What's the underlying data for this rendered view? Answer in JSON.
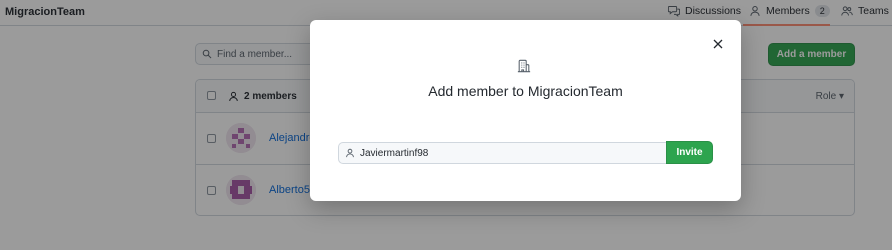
{
  "org": {
    "name": "MigracionTeam"
  },
  "nav": {
    "tabs": [
      {
        "label": "Discussions",
        "icon": "discussion-icon"
      },
      {
        "label": "Members",
        "icon": "person-icon",
        "count": "2"
      },
      {
        "label": "Teams",
        "icon": "people-icon"
      }
    ],
    "active_tab": "Members",
    "underline_color": "#fd8c73"
  },
  "toolbar": {
    "search_placeholder": "Find a member...",
    "add_member_label": "Add a member"
  },
  "table": {
    "members_count_label": "2 members",
    "role_filter_label": "Role ▾",
    "rows": [
      {
        "name": "Alejandro",
        "avatar_color": "#b36bb3"
      },
      {
        "name": "Alberto5",
        "avatar_color": "#a656a6"
      }
    ]
  },
  "modal": {
    "title": "Add member to MigracionTeam",
    "input_value": "Javiermartinf98",
    "invite_label": "Invite"
  },
  "colors": {
    "primary_button": "#2da44e",
    "link": "#0969da",
    "overlay": "rgba(17,17,17,0.42)"
  }
}
